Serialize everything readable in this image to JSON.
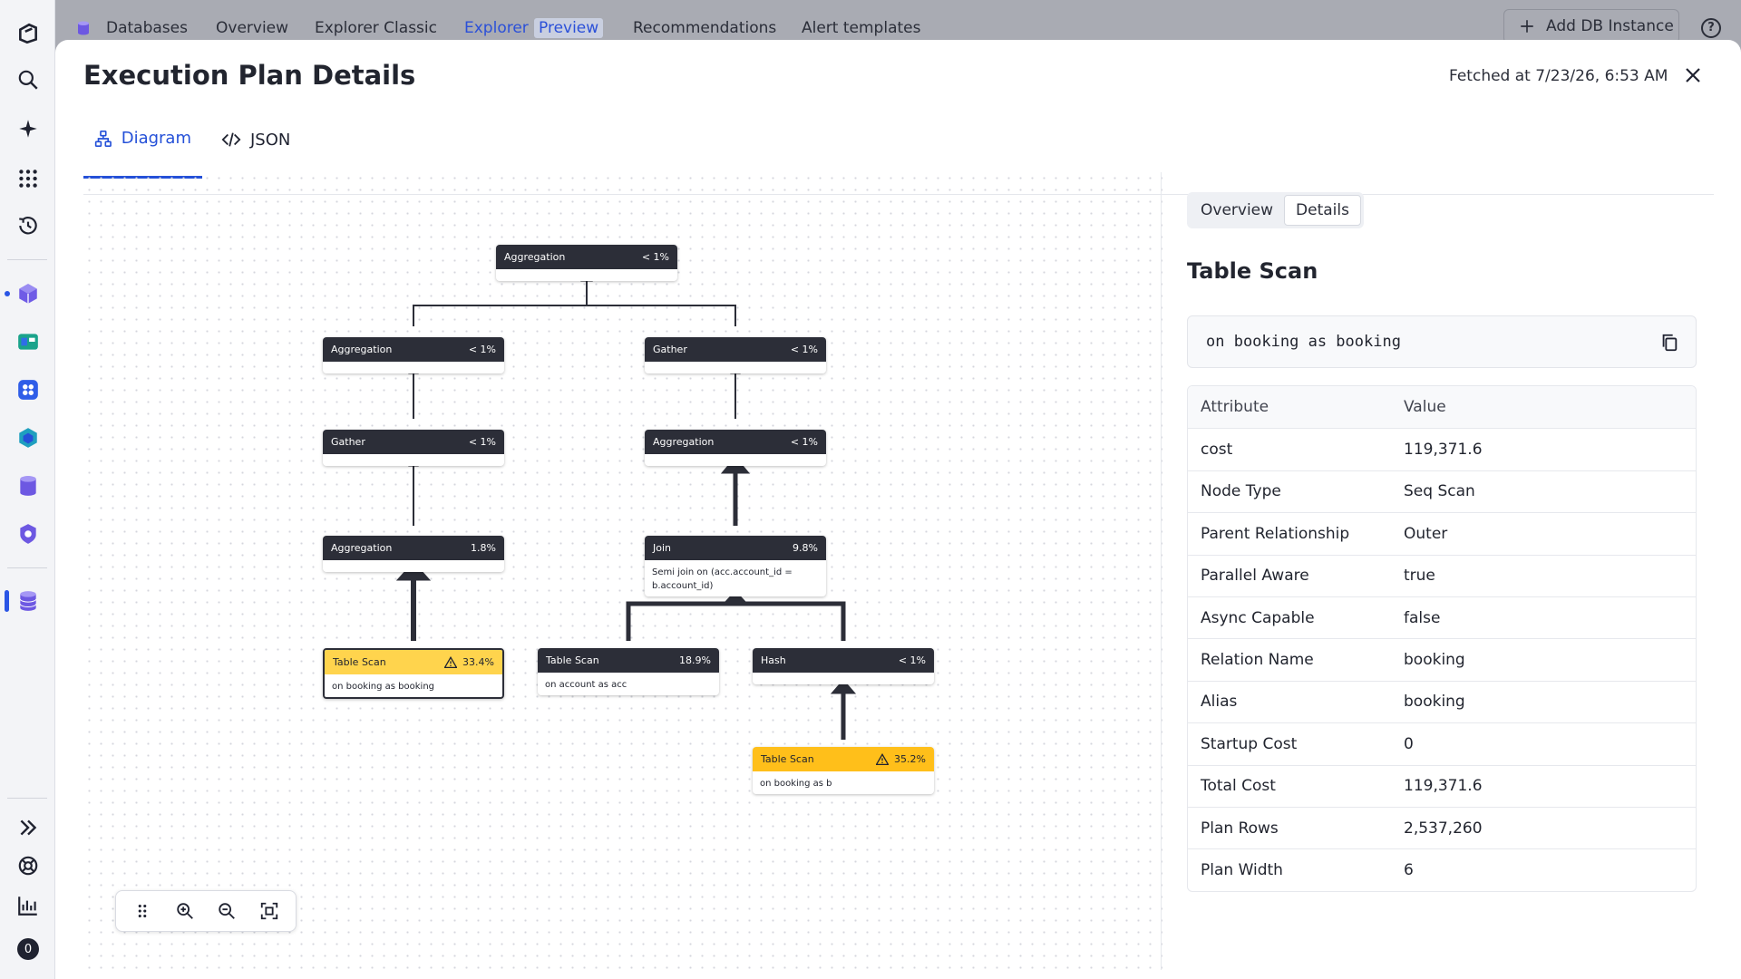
{
  "nav": {
    "items": [
      "Databases",
      "Overview",
      "Explorer Classic",
      "Explorer",
      "Recommendations",
      "Alert templates"
    ],
    "preview_badge": "Preview",
    "add_button": "Add DB Instance",
    "help": "?"
  },
  "rail": {
    "badge": "0"
  },
  "modal": {
    "title": "Execution Plan Details",
    "fetched": "Fetched at 7/23/26, 6:53 AM",
    "tabs": [
      "Diagram",
      "JSON"
    ]
  },
  "diagram": {
    "nodes": [
      {
        "label": "Aggregation",
        "pct": "< 1%",
        "detail": ""
      },
      {
        "label": "Aggregation",
        "pct": "< 1%",
        "detail": ""
      },
      {
        "label": "Gather",
        "pct": "< 1%",
        "detail": ""
      },
      {
        "label": "Gather",
        "pct": "< 1%",
        "detail": ""
      },
      {
        "label": "Aggregation",
        "pct": "< 1%",
        "detail": ""
      },
      {
        "label": "Aggregation",
        "pct": "1.8%",
        "detail": ""
      },
      {
        "label": "Join",
        "pct": "9.8%",
        "detail": "Semi join on (acc.account_id = b.account_id)"
      },
      {
        "label": "Table Scan",
        "pct": "33.4%",
        "detail": "on booking as booking"
      },
      {
        "label": "Table Scan",
        "pct": "18.9%",
        "detail": "on account as acc"
      },
      {
        "label": "Hash",
        "pct": "< 1%",
        "detail": ""
      },
      {
        "label": "Table Scan",
        "pct": "35.2%",
        "detail": "on booking as b"
      }
    ]
  },
  "panel": {
    "segments": [
      "Overview",
      "Details"
    ],
    "title": "Table Scan",
    "code": "on booking as booking",
    "headers": [
      "Attribute",
      "Value"
    ],
    "rows": [
      [
        "cost",
        "119,371.6"
      ],
      [
        "Node Type",
        "Seq Scan"
      ],
      [
        "Parent Relationship",
        "Outer"
      ],
      [
        "Parallel Aware",
        "true"
      ],
      [
        "Async Capable",
        "false"
      ],
      [
        "Relation Name",
        "booking"
      ],
      [
        "Alias",
        "booking"
      ],
      [
        "Startup Cost",
        "0"
      ],
      [
        "Total Cost",
        "119,371.6"
      ],
      [
        "Plan Rows",
        "2,537,260"
      ],
      [
        "Plan Width",
        "6"
      ]
    ]
  }
}
